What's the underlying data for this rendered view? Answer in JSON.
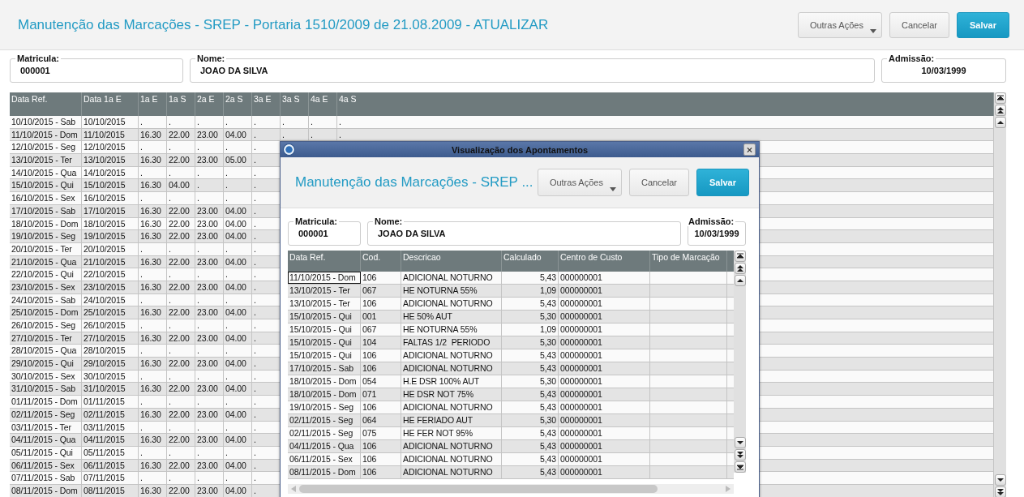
{
  "header": {
    "title": "Manutenção das Marcações - SREP - Portaria 1510/2009 de 21.08.2009 - ATUALIZAR",
    "buttons": [
      {
        "label": "Outras Ações",
        "kind": "menu"
      },
      {
        "label": "Cancelar",
        "kind": "default"
      },
      {
        "label": "Salvar",
        "kind": "primary"
      }
    ]
  },
  "fields": [
    {
      "label": "Matricula:",
      "value": "000001"
    },
    {
      "label": "Nome:",
      "value": "JOAO DA SILVA"
    },
    {
      "label": "Admissão:",
      "value": "10/03/1999"
    }
  ],
  "table": {
    "columns": [
      "Data Ref.",
      "Data 1a E",
      "1a E",
      "1a S",
      "2a E",
      "2a S",
      "3a E",
      "3a S",
      "4a E",
      "4a S"
    ],
    "rows": [
      {
        "cells": [
          "10/10/2015 - Sab",
          "10/10/2015",
          ".",
          ".",
          ".",
          ".",
          ".",
          ".",
          ".",
          "."
        ]
      },
      {
        "cells": [
          "11/10/2015 - Dom",
          "11/10/2015",
          "16.30",
          "22.00",
          "23.00",
          "04.00",
          ".",
          ".",
          ".",
          "."
        ]
      },
      {
        "cells": [
          "12/10/2015 - Seg",
          "12/10/2015",
          ".",
          ".",
          ".",
          ".",
          "."
        ]
      },
      {
        "cells": [
          "13/10/2015 - Ter",
          "13/10/2015",
          "16.30",
          "22.00",
          "23.00",
          "05.00",
          "."
        ]
      },
      {
        "cells": [
          "14/10/2015 - Qua",
          "14/10/2015",
          ".",
          ".",
          ".",
          ".",
          "."
        ]
      },
      {
        "cells": [
          "15/10/2015 - Qui",
          "15/10/2015",
          "16.30",
          "04.00",
          ".",
          ".",
          "."
        ]
      },
      {
        "cells": [
          "16/10/2015 - Sex",
          "16/10/2015",
          ".",
          ".",
          ".",
          ".",
          "."
        ]
      },
      {
        "cells": [
          "17/10/2015 - Sab",
          "17/10/2015",
          "16.30",
          "22.00",
          "23.00",
          "04.00",
          "."
        ]
      },
      {
        "cells": [
          "18/10/2015 - Dom",
          "18/10/2015",
          "16.30",
          "22.00",
          "23.00",
          "04.00",
          "."
        ]
      },
      {
        "cells": [
          "19/10/2015 - Seg",
          "19/10/2015",
          "16.30",
          "22.00",
          "23.00",
          "04.00",
          "."
        ]
      },
      {
        "cells": [
          "20/10/2015 - Ter",
          "20/10/2015",
          ".",
          ".",
          ".",
          ".",
          "."
        ]
      },
      {
        "cells": [
          "21/10/2015 - Qua",
          "21/10/2015",
          "16.30",
          "22.00",
          "23.00",
          "04.00",
          "."
        ]
      },
      {
        "cells": [
          "22/10/2015 - Qui",
          "22/10/2015",
          ".",
          ".",
          ".",
          ".",
          "."
        ]
      },
      {
        "cells": [
          "23/10/2015 - Sex",
          "23/10/2015",
          "16.30",
          "22.00",
          "23.00",
          "04.00",
          "."
        ]
      },
      {
        "cells": [
          "24/10/2015 - Sab",
          "24/10/2015",
          ".",
          ".",
          ".",
          ".",
          "."
        ]
      },
      {
        "cells": [
          "25/10/2015 - Dom",
          "25/10/2015",
          "16.30",
          "22.00",
          "23.00",
          "04.00",
          "."
        ]
      },
      {
        "cells": [
          "26/10/2015 - Seg",
          "26/10/2015",
          ".",
          ".",
          ".",
          ".",
          "."
        ]
      },
      {
        "cells": [
          "27/10/2015 - Ter",
          "27/10/2015",
          "16.30",
          "22.00",
          "23.00",
          "04.00",
          "."
        ]
      },
      {
        "cells": [
          "28/10/2015 - Qua",
          "28/10/2015",
          ".",
          ".",
          ".",
          ".",
          "."
        ]
      },
      {
        "cells": [
          "29/10/2015 - Qui",
          "29/10/2015",
          "16.30",
          "22.00",
          "23.00",
          "04.00",
          "."
        ]
      },
      {
        "cells": [
          "30/10/2015 - Sex",
          "30/10/2015",
          ".",
          ".",
          ".",
          ".",
          "."
        ]
      },
      {
        "cells": [
          "31/10/2015 - Sab",
          "31/10/2015",
          "16.30",
          "22.00",
          "23.00",
          "04.00",
          "."
        ]
      },
      {
        "cells": [
          "01/11/2015 - Dom",
          "01/11/2015",
          ".",
          ".",
          ".",
          ".",
          "."
        ]
      },
      {
        "cells": [
          "02/11/2015 - Seg",
          "02/11/2015",
          "16.30",
          "22.00",
          "23.00",
          "04.00",
          "."
        ]
      },
      {
        "cells": [
          "03/11/2015 - Ter",
          "03/11/2015",
          ".",
          ".",
          ".",
          ".",
          "."
        ]
      },
      {
        "cells": [
          "04/11/2015 - Qua",
          "04/11/2015",
          "16.30",
          "22.00",
          "23.00",
          "04.00",
          "."
        ]
      },
      {
        "cells": [
          "05/11/2015 - Qui",
          "05/11/2015",
          ".",
          ".",
          ".",
          ".",
          "."
        ]
      },
      {
        "cells": [
          "06/11/2015 - Sex",
          "06/11/2015",
          "16.30",
          "22.00",
          "23.00",
          "04.00",
          "."
        ]
      },
      {
        "cells": [
          "07/11/2015 - Sab",
          "07/11/2015",
          ".",
          ".",
          ".",
          ".",
          "."
        ]
      },
      {
        "cells": [
          "08/11/2015 - Dom",
          "08/11/2015",
          "16.30",
          "22.00",
          "23.00",
          "04.00",
          "."
        ]
      }
    ]
  },
  "dialog": {
    "title": "Visualização dos Apontamentos",
    "header": {
      "title": "Manutenção das Marcações - SREP ...",
      "buttons": [
        {
          "label": "Outras Ações",
          "kind": "menu"
        },
        {
          "label": "Cancelar",
          "kind": "default"
        },
        {
          "label": "Salvar",
          "kind": "primary"
        }
      ]
    },
    "fields": [
      {
        "label": "Matricula:",
        "value": "000001"
      },
      {
        "label": "Nome:",
        "value": "JOAO DA SILVA"
      },
      {
        "label": "Admissão:",
        "value": "10/03/1999"
      }
    ],
    "table": {
      "columns": [
        "Data Ref.",
        "Cod.",
        "Descricao",
        "Calculado",
        "Centro de Custo",
        "Tipo de Marcação"
      ],
      "rows": [
        {
          "selected": true,
          "cells": [
            "11/10/2015 - Dom",
            "106",
            "ADICIONAL NOTURNO",
            "5,43",
            "000000001"
          ]
        },
        {
          "selected": false,
          "cells": [
            "13/10/2015 - Ter",
            "067",
            "HE NOTURNA 55%",
            "1,09",
            "000000001"
          ]
        },
        {
          "selected": false,
          "cells": [
            "13/10/2015 - Ter",
            "106",
            "ADICIONAL NOTURNO",
            "5,43",
            "000000001"
          ]
        },
        {
          "selected": false,
          "cells": [
            "15/10/2015 - Qui",
            "001",
            "HE 50% AUT",
            "5,30",
            "000000001"
          ]
        },
        {
          "selected": false,
          "cells": [
            "15/10/2015 - Qui",
            "067",
            "HE NOTURNA 55%",
            "1,09",
            "000000001"
          ]
        },
        {
          "selected": false,
          "cells": [
            "15/10/2015 - Qui",
            "104",
            "FALTAS 1/2  PERIODO",
            "5,30",
            "000000001"
          ]
        },
        {
          "selected": false,
          "cells": [
            "15/10/2015 - Qui",
            "106",
            "ADICIONAL NOTURNO",
            "5,43",
            "000000001"
          ]
        },
        {
          "selected": false,
          "cells": [
            "17/10/2015 - Sab",
            "106",
            "ADICIONAL NOTURNO",
            "5,43",
            "000000001"
          ]
        },
        {
          "selected": false,
          "cells": [
            "18/10/2015 - Dom",
            "054",
            "H.E DSR 100% AUT",
            "5,30",
            "000000001"
          ]
        },
        {
          "selected": false,
          "cells": [
            "18/10/2015 - Dom",
            "071",
            "HE DSR NOT 75%",
            "5,43",
            "000000001"
          ]
        },
        {
          "selected": false,
          "cells": [
            "19/10/2015 - Seg",
            "106",
            "ADICIONAL NOTURNO",
            "5,43",
            "000000001"
          ]
        },
        {
          "selected": false,
          "cells": [
            "02/11/2015 - Seg",
            "064",
            "HE FERIADO AUT",
            "5,30",
            "000000001"
          ]
        },
        {
          "selected": false,
          "cells": [
            "02/11/2015 - Seg",
            "075",
            "HE FER NOT 95%",
            "5,43",
            "000000001"
          ]
        },
        {
          "selected": false,
          "cells": [
            "04/11/2015 - Qua",
            "106",
            "ADICIONAL NOTURNO",
            "5,43",
            "000000001"
          ]
        },
        {
          "selected": false,
          "cells": [
            "06/11/2015 - Sex",
            "106",
            "ADICIONAL NOTURNO",
            "5,43",
            "000000001"
          ]
        },
        {
          "selected": false,
          "cells": [
            "08/11/2015 - Dom",
            "106",
            "ADICIONAL NOTURNO",
            "5,43",
            "000000001"
          ]
        }
      ]
    }
  }
}
